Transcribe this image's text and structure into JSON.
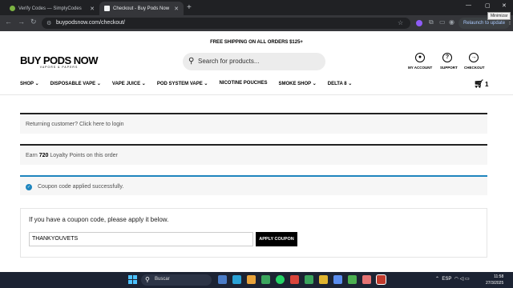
{
  "browser": {
    "tabs": [
      {
        "title": "Verify Codes — SimplyCodes",
        "active": false,
        "favicon_color": "#7cb342"
      },
      {
        "title": "Checkout - Buy Pods Now",
        "active": true,
        "favicon_color": "#f1f3f4"
      }
    ],
    "new_tab_icon": "plus-icon",
    "url": "buypodsnow.com/checkout/",
    "relaunch_label": "Relaunch to update",
    "tooltip": "Minimizar",
    "window_controls": [
      "minimize-icon",
      "maximize-icon",
      "close-icon"
    ]
  },
  "site": {
    "promo": "FREE SHIPPING ON ALL ORDERS $125+",
    "logo": {
      "name": "BUY PODS NOW",
      "tagline": "VAPORS & PAPERS"
    },
    "search_placeholder": "Search for products...",
    "header_links": [
      {
        "label": "MY ACCOUNT",
        "icon": "account-icon"
      },
      {
        "label": "SUPPORT",
        "icon": "help-icon"
      },
      {
        "label": "CHECKOUT",
        "icon": "arrow-right-circle-icon"
      }
    ],
    "nav": [
      {
        "label": "SHOP",
        "has_dropdown": true
      },
      {
        "label": "DISPOSABLE VAPE",
        "has_dropdown": true
      },
      {
        "label": "VAPE JUICE",
        "has_dropdown": true
      },
      {
        "label": "POD SYSTEM VAPE",
        "has_dropdown": true
      },
      {
        "label": "NICOTINE POUCHES",
        "has_dropdown": false
      },
      {
        "label": "SMOKE SHOP",
        "has_dropdown": true
      },
      {
        "label": "DELTA 8",
        "has_dropdown": true
      }
    ],
    "cart_count": "1"
  },
  "checkout": {
    "returning_prefix": "Returning customer?",
    "login_link": "Click here to login",
    "loyalty_prefix": "Earn",
    "loyalty_points": "720",
    "loyalty_suffix": "Loyalty Points on this order",
    "coupon_success": "Coupon code applied successfully.",
    "coupon_prompt": "If you have a coupon code, please apply it below.",
    "coupon_value": "THANKYOUVETS",
    "apply_label": "APPLY COUPON"
  },
  "taskbar": {
    "search_label": "Buscar",
    "language": "ESP",
    "time": "11:58",
    "date": "27/3/2025"
  },
  "colors": {
    "accent_blue": "#1e85be",
    "nav_text": "#000000",
    "notice_bg": "#f6f6f6"
  }
}
